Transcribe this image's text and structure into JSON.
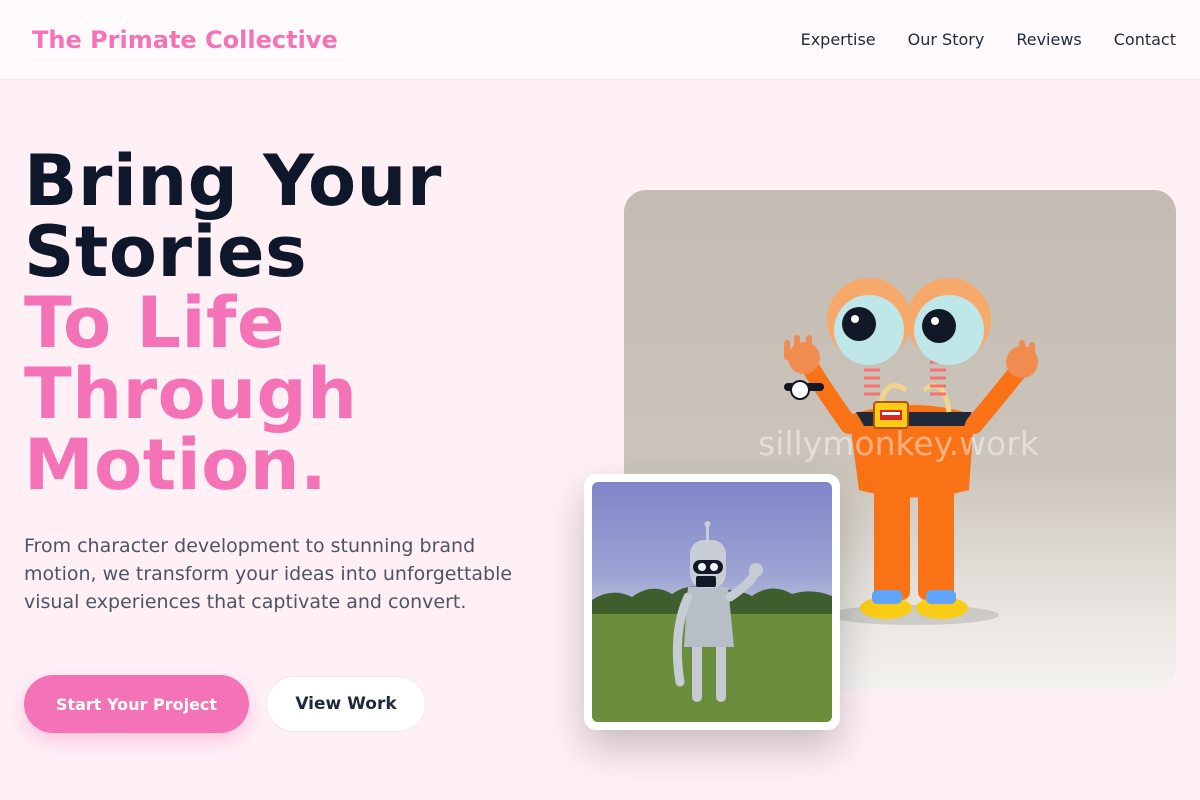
{
  "nav": {
    "logo": "The Primate Collective",
    "links": [
      "Expertise",
      "Our Story",
      "Reviews",
      "Contact"
    ]
  },
  "hero": {
    "headline_dark": [
      "Bring Your",
      "Stories"
    ],
    "headline_pink": [
      "To Life",
      "Through",
      "Motion."
    ],
    "description": "From character development to stunning brand motion, we transform your ideas into unforgettable visual experiences that captivate and convert.",
    "primary_button": "Start Your Project",
    "secondary_button": "View Work",
    "image_watermark": "sillymonkey.work"
  },
  "colors": {
    "accent": "#f472b6",
    "background": "#fff0f6",
    "heading": "#0f172a"
  }
}
